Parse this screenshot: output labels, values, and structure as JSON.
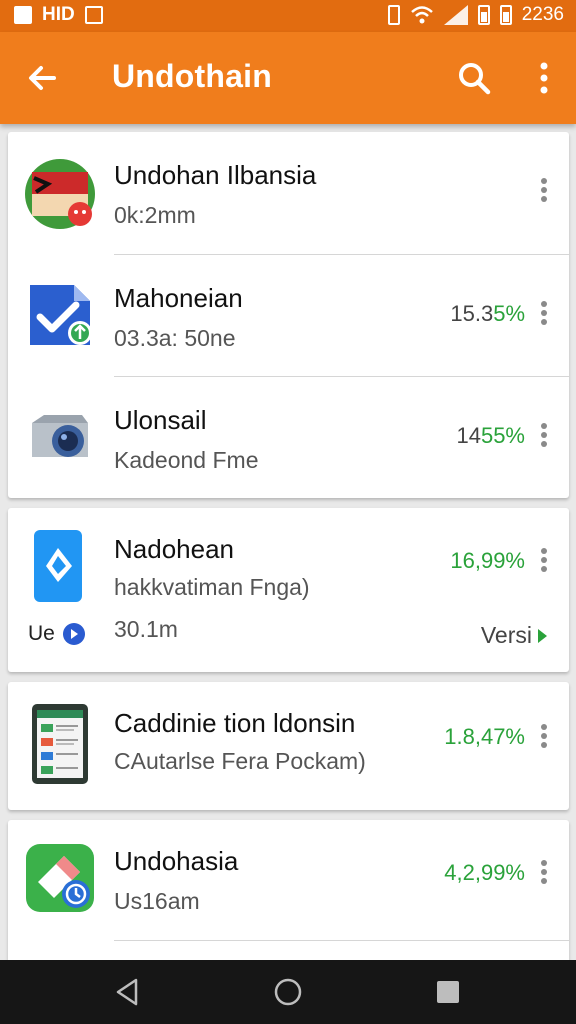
{
  "status_bar": {
    "left_label": "HID",
    "time": "2236",
    "icons": [
      "image-icon",
      "hd-icon",
      "mail-icon",
      "vibrate-icon",
      "wifi-icon",
      "signal-icon",
      "battery-icon",
      "battery-icon"
    ]
  },
  "app_bar": {
    "title": "Undothain",
    "icons": [
      "back-arrow-icon",
      "search-icon",
      "more-vert-icon"
    ]
  },
  "colors": {
    "status_bar": "#e26c10",
    "app_bar": "#f07d1c",
    "green": "#2aa23a",
    "nav_bar": "#161616"
  },
  "cards": [
    {
      "items": [
        {
          "name": "Undohan Ilbansia",
          "sub": "0k:2mm",
          "icon": "flag-app-icon",
          "pct_prefix": "",
          "pct_colored": ""
        },
        {
          "name": "Mahoneian",
          "sub": "03.3a: 50ne",
          "icon": "check-document-app-icon",
          "pct_prefix": "15.3",
          "pct_colored": "5%"
        },
        {
          "name": "Ulonsail",
          "sub": "Kadeond Fme",
          "icon": "camera-app-icon",
          "pct_prefix": "14",
          "pct_colored": "55%"
        }
      ]
    },
    {
      "items": [
        {
          "name": "Nadohean",
          "sub": "hakkvatiman Fnga)",
          "sub2": "30.1m",
          "icon": "diamond-app-icon",
          "pct_prefix": "",
          "pct_colored": "16,99%"
        }
      ],
      "footer": {
        "left_label": "Ue",
        "right_label": "Versi"
      }
    },
    {
      "items": [
        {
          "name": "Caddinie tion ldonsin",
          "sub": "CAutarlse Fera Pockam)",
          "icon": "tablet-app-icon",
          "pct_prefix": "",
          "pct_colored": "1.8,47%"
        }
      ]
    },
    {
      "items": [
        {
          "name": "Undohasia",
          "sub": "Us16am",
          "icon": "eraser-app-icon",
          "pct_prefix": "",
          "pct_colored": "4,2,99%"
        }
      ]
    }
  ],
  "nav_bar": {
    "icons": [
      "back-triangle-icon",
      "home-circle-icon",
      "recents-square-icon"
    ]
  }
}
